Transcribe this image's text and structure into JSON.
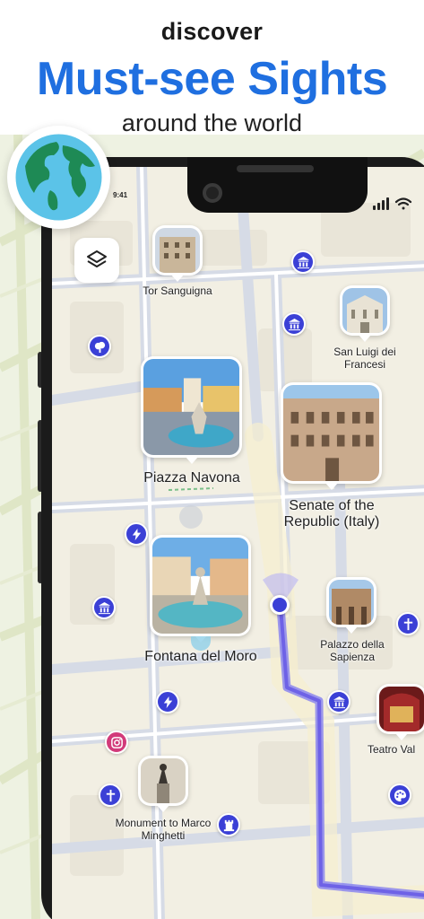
{
  "promo": {
    "line1": "discover",
    "line2": "Must-see Sights",
    "line3": "around the world"
  },
  "status": {
    "time": "9:41"
  },
  "colors": {
    "accent": "#1f6fe0",
    "poi": "#3b40d6",
    "route": "#6e62e6"
  },
  "map": {
    "layers_icon": "layers-icon",
    "places": [
      {
        "name": "Tor Sanguigna"
      },
      {
        "name": "San Luigi dei Francesi"
      },
      {
        "name": "Piazza Navona"
      },
      {
        "name": "Senate of the Republic (Italy)"
      },
      {
        "name": "Fontana del Moro"
      },
      {
        "name": "Palazzo della Sapienza"
      },
      {
        "name": "Teatro Val"
      },
      {
        "name": "Monument to Marco Minghetti"
      }
    ],
    "pois": [
      "museum-icon",
      "museum-icon",
      "tree-icon",
      "lightning-icon",
      "museum-icon",
      "cross-icon",
      "lightning-icon",
      "museum-icon",
      "instagram-icon",
      "cross-icon",
      "tower-icon",
      "palette-icon"
    ]
  }
}
